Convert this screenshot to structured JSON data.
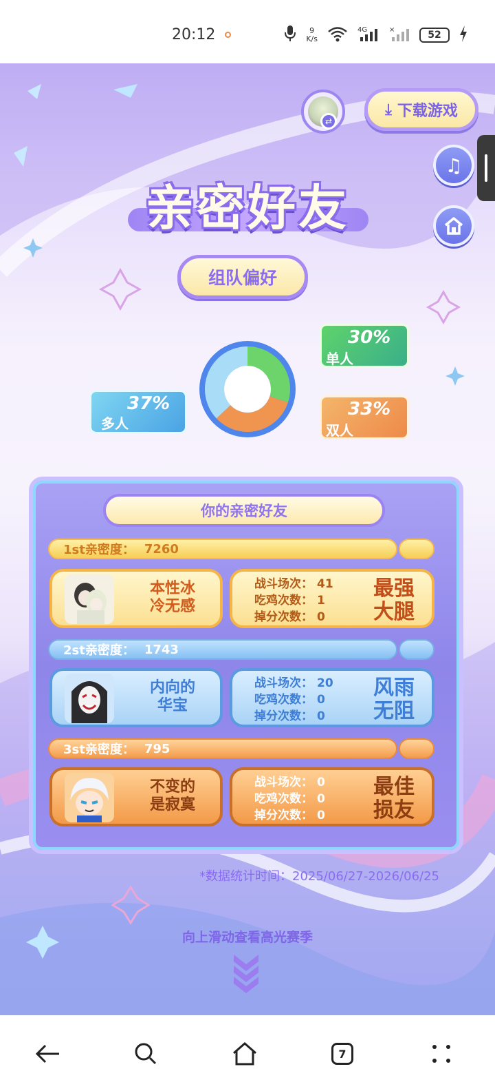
{
  "status_bar": {
    "time": "20:12",
    "net_speed_top": "9",
    "net_speed_unit": "K/s",
    "network_label": "4G",
    "battery": "52"
  },
  "header": {
    "download_label": "下载游戏"
  },
  "title": "亲密好友",
  "team_preference": {
    "label": "组队偏好",
    "slices": [
      {
        "label": "单人",
        "value": 30,
        "display": "30%",
        "color": "#6dd46c"
      },
      {
        "label": "双人",
        "value": 33,
        "display": "33%",
        "color": "#f09550"
      },
      {
        "label": "多人",
        "value": 37,
        "display": "37%",
        "color": "#a9dcf6"
      }
    ],
    "ring_color": "#4f86ec"
  },
  "friends_panel": {
    "title": "你的亲密好友",
    "stat_labels": {
      "battles": "战斗场次：",
      "chicken": "吃鸡次数：",
      "drops": "掉分次数："
    },
    "friends": [
      {
        "rank_label": "1st亲密度：",
        "intimacy": "7260",
        "name_line1": "本性冰",
        "name_line2": "冷无感",
        "battles": "41",
        "chicken": "1",
        "drops": "0",
        "badge_line1": "最强",
        "badge_line2": "大腿",
        "theme": "gold"
      },
      {
        "rank_label": "2st亲密度：",
        "intimacy": "1743",
        "name_line1": "内向的",
        "name_line2": "华宝",
        "battles": "20",
        "chicken": "0",
        "drops": "0",
        "badge_line1": "风雨",
        "badge_line2": "无阻",
        "theme": "blue"
      },
      {
        "rank_label": "3st亲密度：",
        "intimacy": "795",
        "name_line1": "不变的",
        "name_line2": "是寂寞",
        "battles": "0",
        "chicken": "0",
        "drops": "0",
        "badge_line1": "最佳",
        "badge_line2": "损友",
        "theme": "orange"
      }
    ]
  },
  "stats_note": "*数据统计时间：2025/06/27-2026/06/25",
  "scroll_hint": "向上滑动查看高光赛季",
  "nav": {
    "tabs_count": "7"
  }
}
